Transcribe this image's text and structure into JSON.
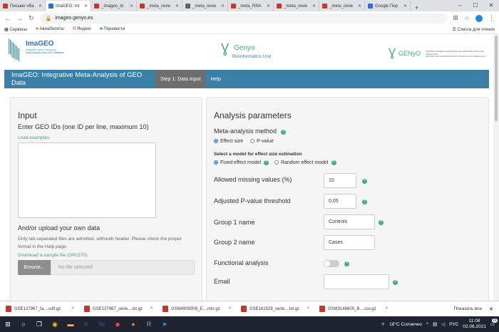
{
  "browser": {
    "tabs": [
      {
        "label": "Письмо «Ba",
        "color": "#d93025"
      },
      {
        "label": "ImaGEO: Int",
        "color": "#2b6fd6",
        "active": true
      },
      {
        "label": "_imageo_bi",
        "color": "#d93025"
      },
      {
        "label": "_meta_revie",
        "color": "#d93025"
      },
      {
        "label": "_meta_revie",
        "color": "#5f6368"
      },
      {
        "label": "_meta_RNA",
        "color": "#d93025"
      },
      {
        "label": "_meta_revie",
        "color": "#d93025"
      },
      {
        "label": "_meta_revie",
        "color": "#d93025"
      },
      {
        "label": "Google Пер",
        "color": "#2b6fd6"
      }
    ],
    "url": "imageo.genyo.es",
    "bookmarks": [
      "Сервисы",
      "Авиабилеты",
      "Яндекс",
      "Перевести"
    ],
    "bookmarks_right": "Список для чтения"
  },
  "header": {
    "logo_text": "ImaGEO",
    "logo_sub1": "Integrative gene expression",
    "logo_sub2": "Meta-Analysis from GEO database",
    "genyo_text": "Genyo",
    "genyo_sub": "Bioinformatics Unit",
    "genyo2_text": "GENyO",
    "genyo2_sub1": "CENTRO PFIZER-UNIVERSIDAD DE GRANADA-JUNTA DE ANDALUCÍA",
    "genyo2_sub2": "CENTRE FOR GENOMICS AND ONCOLOGICAL RESEARCH"
  },
  "navbar": {
    "brand": "ImaGEO: Integrative Meta-Analysis of GEO Data",
    "items": [
      "Step 1: Data Input",
      "Help"
    ]
  },
  "input_panel": {
    "title": "Input",
    "subtitle": "Enter GEO IDs (one ID per line, maximum 10)",
    "load_examples": "Load examples",
    "upload_title": "And/or upload your own data",
    "upload_note": "Only tab-separated files are admitted, withouth header. Please check the proper format in the Help page.",
    "download_link": "Download a sample file (GPL570)",
    "browse_label": "Browse...",
    "file_status": "No file selected"
  },
  "params_panel": {
    "title": "Analysis parameters",
    "method_label": "Meta-analysis method",
    "method_options": [
      "Effect size",
      "P-value"
    ],
    "model_label": "Select a model for effect size estimation",
    "model_options": [
      "Fixed effect model",
      "Random effect model"
    ],
    "missing_label": "Allowed missing values (%)",
    "missing_value": "10",
    "pvalue_label": "Adjusted P-value threshold",
    "pvalue_value": "0,05",
    "group1_label": "Group 1 name",
    "group1_value": "Controls",
    "group2_label": "Group 2 name",
    "group2_value": "Cases",
    "functional_label": "Functional analysis",
    "email_label": "Email",
    "email_value": ""
  },
  "downloads": {
    "items": [
      "GSE137967_fa....soft.gz",
      "GSE137967_serie....txt.gz",
      "GSM4909308_E....mtx.gz",
      "GSE161529_serie....txt.gz",
      "GSM3148600_B....csv.gz"
    ],
    "show_all": "Показать все"
  },
  "taskbar": {
    "weather": "18°C Солнечно",
    "lang": "РУС",
    "time": "11:08",
    "date": "02.06.2021",
    "notif_count": "21"
  },
  "colors": {
    "navbar": "#3a7fa6",
    "active_nav": "#6e6e6e",
    "accent_green": "#3fae82"
  }
}
